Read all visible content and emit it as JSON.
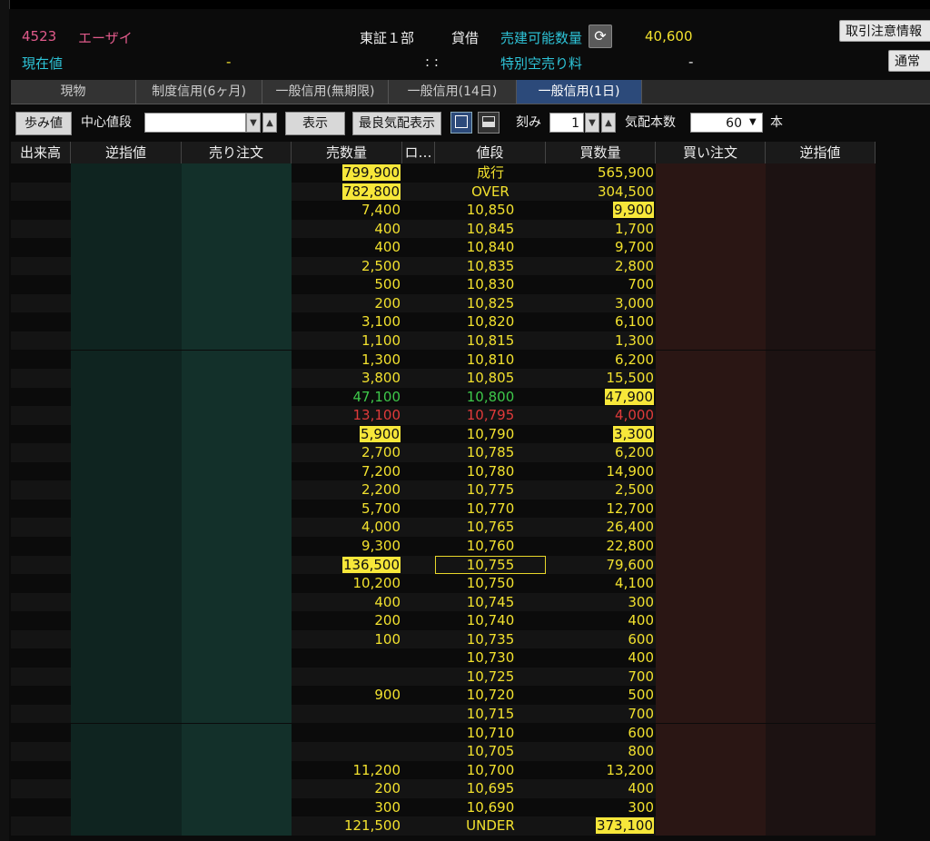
{
  "header": {
    "code": "4523",
    "name": "エーザイ",
    "market": "東証１部",
    "lending": "貸借",
    "sellable_label": "売建可能数量",
    "sellable_value": "40,600",
    "current_label": "現在値",
    "current_value": "-",
    "current_time": ": :",
    "short_fee_label": "特別空売り料",
    "short_fee_value": "-",
    "notice_button": "取引注意情報",
    "normal_button": "通常"
  },
  "tabs": [
    "現物",
    "制度信用(6ヶ月)",
    "一般信用(無期限)",
    "一般信用(14日)",
    "一般信用(1日)"
  ],
  "active_tab": 4,
  "toolbar": {
    "ticks_button": "歩み値",
    "center_label": "中心値段",
    "center_value": "",
    "show_button": "表示",
    "best_button": "最良気配表示",
    "tick_label": "刻み",
    "tick_value": "1",
    "depth_label": "気配本数",
    "depth_value": "60",
    "unit": "本"
  },
  "columns": [
    "出来高",
    "逆指値",
    "売り注文",
    "売数量",
    "ロ…",
    "値段",
    "買数量",
    "買い注文",
    "逆指値"
  ],
  "rows": [
    {
      "sell": "799,900",
      "price": "成行",
      "buy": "565,900",
      "sell_hl": true
    },
    {
      "sell": "782,800",
      "price": "OVER",
      "buy": "304,500",
      "sell_hl": true
    },
    {
      "sell": "7,400",
      "price": "10,850",
      "buy": "9,900",
      "buy_hl": true
    },
    {
      "sell": "400",
      "price": "10,845",
      "buy": "1,700"
    },
    {
      "sell": "400",
      "price": "10,840",
      "buy": "9,700"
    },
    {
      "sell": "2,500",
      "price": "10,835",
      "buy": "2,800"
    },
    {
      "sell": "500",
      "price": "10,830",
      "buy": "700"
    },
    {
      "sell": "200",
      "price": "10,825",
      "buy": "3,000"
    },
    {
      "sell": "3,100",
      "price": "10,820",
      "buy": "6,100"
    },
    {
      "sell": "1,100",
      "price": "10,815",
      "buy": "1,300"
    },
    {
      "sell": "1,300",
      "price": "10,810",
      "buy": "6,200"
    },
    {
      "sell": "3,800",
      "price": "10,805",
      "buy": "15,500"
    },
    {
      "sell": "47,100",
      "price": "10,800",
      "buy": "47,900",
      "color": "green",
      "buy_hl": true
    },
    {
      "sell": "13,100",
      "price": "10,795",
      "buy": "4,000",
      "color": "red"
    },
    {
      "sell": "5,900",
      "price": "10,790",
      "buy": "3,300",
      "sell_hl": true,
      "buy_hl": true
    },
    {
      "sell": "2,700",
      "price": "10,785",
      "buy": "6,200"
    },
    {
      "sell": "7,200",
      "price": "10,780",
      "buy": "14,900"
    },
    {
      "sell": "2,200",
      "price": "10,775",
      "buy": "2,500"
    },
    {
      "sell": "5,700",
      "price": "10,770",
      "buy": "12,700"
    },
    {
      "sell": "4,000",
      "price": "10,765",
      "buy": "26,400"
    },
    {
      "sell": "9,300",
      "price": "10,760",
      "buy": "22,800"
    },
    {
      "sell": "136,500",
      "price": "10,755",
      "buy": "79,600",
      "sell_hl": true,
      "boxed": true
    },
    {
      "sell": "10,200",
      "price": "10,750",
      "buy": "4,100"
    },
    {
      "sell": "400",
      "price": "10,745",
      "buy": "300"
    },
    {
      "sell": "200",
      "price": "10,740",
      "buy": "400"
    },
    {
      "sell": "100",
      "price": "10,735",
      "buy": "600"
    },
    {
      "sell": "",
      "price": "10,730",
      "buy": "400"
    },
    {
      "sell": "",
      "price": "10,725",
      "buy": "700"
    },
    {
      "sell": "900",
      "price": "10,720",
      "buy": "500"
    },
    {
      "sell": "",
      "price": "10,715",
      "buy": "700"
    },
    {
      "sell": "",
      "price": "10,710",
      "buy": "600"
    },
    {
      "sell": "",
      "price": "10,705",
      "buy": "800"
    },
    {
      "sell": "11,200",
      "price": "10,700",
      "buy": "13,200"
    },
    {
      "sell": "200",
      "price": "10,695",
      "buy": "400"
    },
    {
      "sell": "300",
      "price": "10,690",
      "buy": "300"
    },
    {
      "sell": "121,500",
      "price": "UNDER",
      "buy": "373,100",
      "buy_hl": true
    }
  ],
  "colors": {
    "yellow": "#f2e12e",
    "highlight": "#f7e73a",
    "green": "#3ec84a",
    "red": "#e03a3a",
    "cyan": "#2ec4d8",
    "pink": "#e05a8a"
  }
}
